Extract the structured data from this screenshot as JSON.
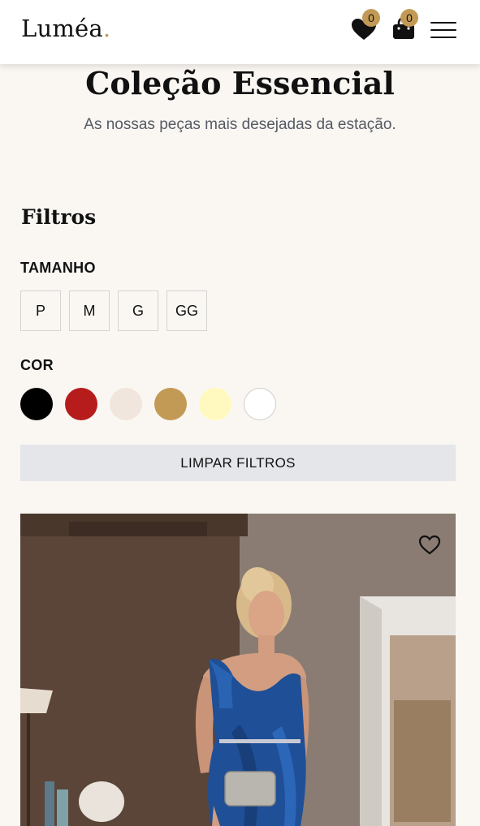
{
  "header": {
    "logo_text": "Luméa",
    "logo_dot": ".",
    "wishlist_count": "0",
    "cart_count": "0",
    "icons": {
      "wishlist": "heart-icon",
      "cart": "shopping-bag-icon",
      "menu": "hamburger-menu-icon"
    },
    "accent_color": "#c39a55"
  },
  "hero": {
    "title": "Coleção Essencial",
    "subtitle": "As nossas peças mais desejadas da estação."
  },
  "filters": {
    "heading": "Filtros",
    "size_label": "TAMANHO",
    "sizes": [
      "P",
      "M",
      "G",
      "GG"
    ],
    "color_label": "COR",
    "colors": [
      "#000000",
      "#b71c1c",
      "#f0e6de",
      "#c39a55",
      "#fff9bf",
      "#ffffff"
    ],
    "clear_label": "LIMPAR FILTROS"
  },
  "product": {
    "favorite_icon": "heart-outline-icon"
  }
}
